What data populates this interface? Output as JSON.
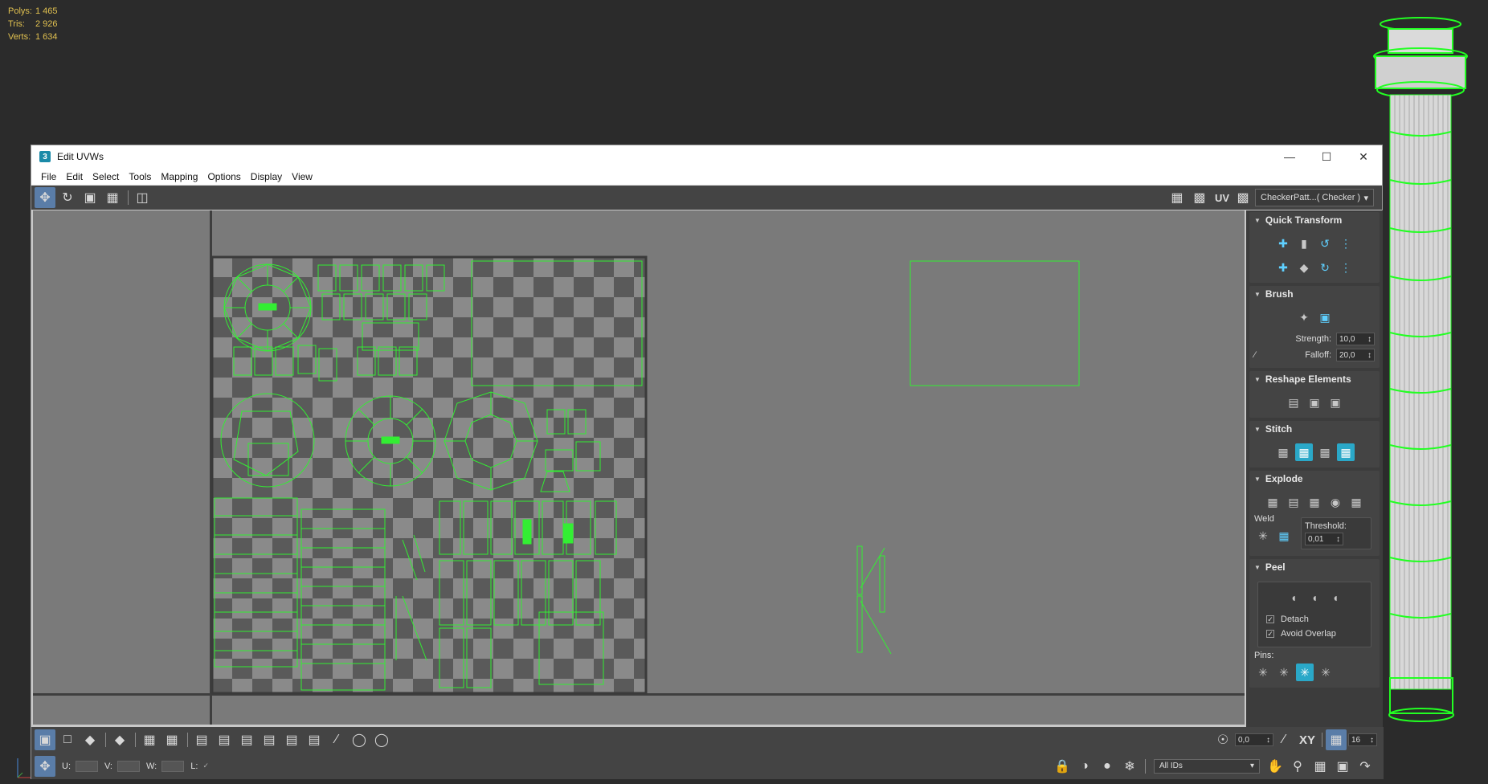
{
  "scene_stats": [
    {
      "label": "Polys:",
      "value": "1 465"
    },
    {
      "label": "Tris:",
      "value": "2 926"
    },
    {
      "label": "Verts:",
      "value": "1 634"
    }
  ],
  "window": {
    "title": "Edit UVWs",
    "app_icon": "3"
  },
  "menu": [
    "File",
    "Edit",
    "Select",
    "Tools",
    "Mapping",
    "Options",
    "Display",
    "View"
  ],
  "toolbar": {
    "uv_label": "UV",
    "texture_select": "CheckerPatt...( Checker )"
  },
  "panels": {
    "quick_transform": {
      "title": "Quick Transform"
    },
    "brush": {
      "title": "Brush",
      "strength_label": "Strength:",
      "strength_value": "10,0",
      "falloff_label": "Falloff:",
      "falloff_value": "20,0"
    },
    "reshape": {
      "title": "Reshape Elements"
    },
    "stitch": {
      "title": "Stitch"
    },
    "explode": {
      "title": "Explode",
      "weld_label": "Weld",
      "threshold_label": "Threshold:",
      "threshold_value": "0,01"
    },
    "peel": {
      "title": "Peel",
      "detach_label": "Detach",
      "avoid_overlap_label": "Avoid Overlap",
      "pins_label": "Pins:"
    }
  },
  "bottom": {
    "u_label": "U:",
    "v_label": "V:",
    "w_label": "W:",
    "l_label": "L:",
    "soft_value": "0,0",
    "xy_label": "XY",
    "grid_value": "16",
    "ids_select": "All IDs"
  },
  "colors": {
    "uv_wire": "#33ee33",
    "accent": "#5fd0ff",
    "stats": "#e0c050"
  }
}
